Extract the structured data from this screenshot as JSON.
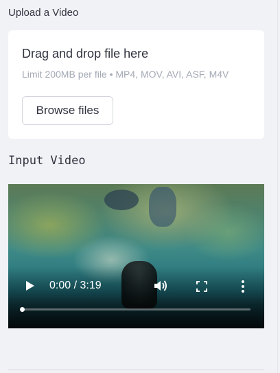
{
  "uploader": {
    "label": "Upload a Video",
    "drop_title": "Drag and drop file here",
    "limit_text": "Limit 200MB per file • MP4, MOV, AVI, ASF, M4V",
    "browse_label": "Browse files"
  },
  "video_section": {
    "label": "Input Video",
    "player": {
      "time_text": "0:00 / 3:19",
      "progress": 0.0,
      "icons": [
        "play-icon",
        "volume-icon",
        "fullscreen-icon",
        "more-options-icon"
      ]
    }
  },
  "colors": {
    "background": "#f0f2f6",
    "card": "#ffffff",
    "text": "#31333f",
    "muted_text": "#a3a8b4"
  }
}
